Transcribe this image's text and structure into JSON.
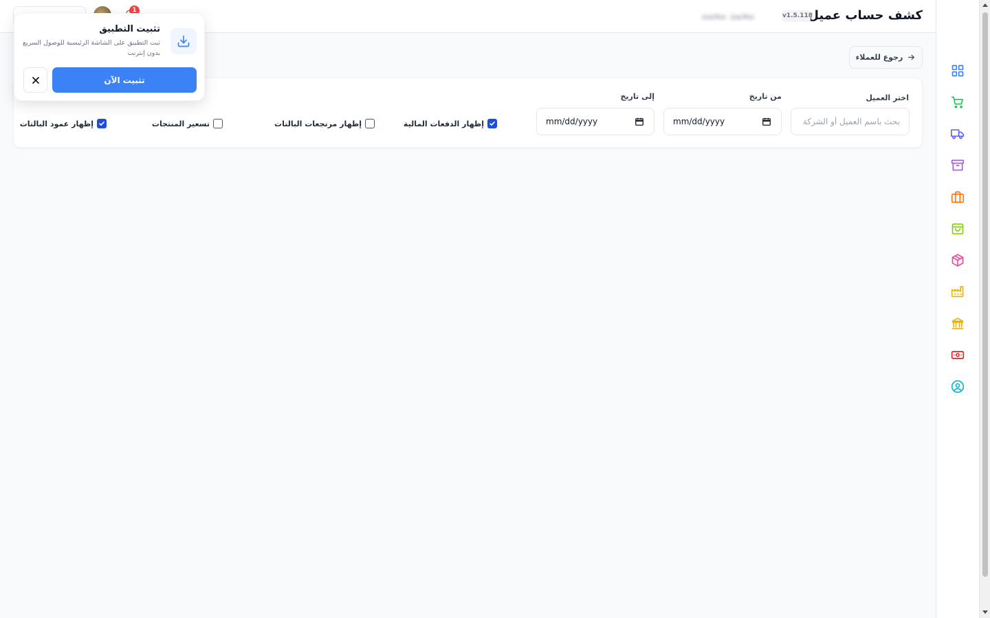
{
  "header": {
    "title": "كشف حساب عميل",
    "version": "v1.5.118",
    "user_name": "محمد محمد",
    "notification_count": "1"
  },
  "back_button": {
    "label": "رجوع للعملاء",
    "icon": "arrow-right-icon"
  },
  "filters": {
    "customer": {
      "label": "اختر العميل",
      "placeholder": "بحث باسم العميل أو الشركة",
      "value": ""
    },
    "from_date": {
      "label": "من تاريخ",
      "placeholder": "mm/dd/yyyy"
    },
    "to_date": {
      "label": "إلى تاريخ",
      "placeholder": "mm/dd/yyyy"
    },
    "options": [
      {
        "label": "إظهار الدفعات المالية",
        "checked": true
      },
      {
        "label": "إظهار مرتجعات البالتات",
        "checked": false
      },
      {
        "label": "تسعير المنتجات",
        "checked": false
      },
      {
        "label": "إظهار عمود البالتات",
        "checked": true
      }
    ]
  },
  "install_popup": {
    "title": "تثبيت التطبيق",
    "description": "ثبت التطبيق على الشاشة الرئيسية للوصول السريع بدون إنترنت",
    "install_label": "تثبيت الآن",
    "icon": "download-icon"
  },
  "sidebar": {
    "items": [
      {
        "icon": "dashboard-icon",
        "color": "#3b82f6"
      },
      {
        "icon": "cart-icon",
        "color": "#22c55e"
      },
      {
        "icon": "truck-icon",
        "color": "#6366f1"
      },
      {
        "icon": "archive-icon",
        "color": "#a855f7"
      },
      {
        "icon": "briefcase-icon",
        "color": "#f97316"
      },
      {
        "icon": "shopping-bag-icon",
        "color": "#84cc16"
      },
      {
        "icon": "package-icon",
        "color": "#ec4899"
      },
      {
        "icon": "factory-icon",
        "color": "#eab308"
      },
      {
        "icon": "bank-icon",
        "color": "#eab308"
      },
      {
        "icon": "cash-icon",
        "color": "#dc2626"
      },
      {
        "icon": "user-circle-icon",
        "color": "#06b6d4"
      }
    ]
  }
}
